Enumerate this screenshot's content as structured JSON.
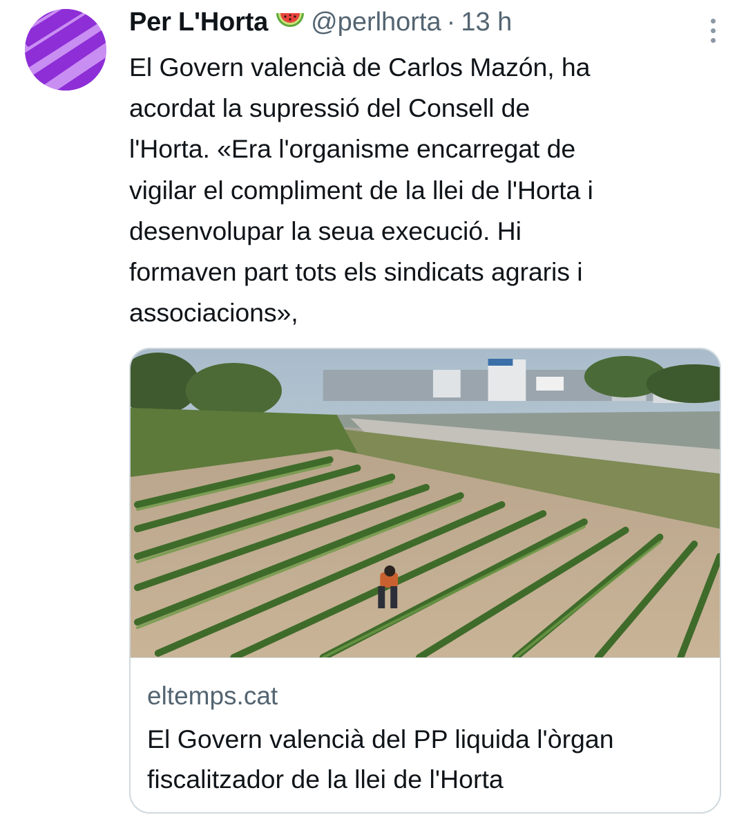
{
  "tweet": {
    "author": {
      "display_name": "Per L'Horta",
      "emoji_icon": "watermelon-emoji",
      "handle": "@perlhorta",
      "separator": "·",
      "time": "13 h",
      "avatar_colors": [
        "#c58bf0",
        "#8f2fd6"
      ]
    },
    "more_icon": "more-vertical-icon",
    "text_lines": [
      "El Govern valencià de Carlos Mazón, ha",
      "acordat la supressió del Consell de",
      "l'Horta. «Era l'organisme encarregat de",
      "vigilar el compliment de la llei de l'Horta i",
      "desenvolupar la seua execució. Hi",
      "formaven part tots els sindicats agraris i",
      "associacions»,"
    ],
    "card": {
      "image_description_icon": "field-photo",
      "domain": "eltemps.cat",
      "title_lines": [
        "El Govern valencià del PP liquida l'òrgan",
        "fiscalitzador de la llei de l'Horta"
      ]
    }
  }
}
